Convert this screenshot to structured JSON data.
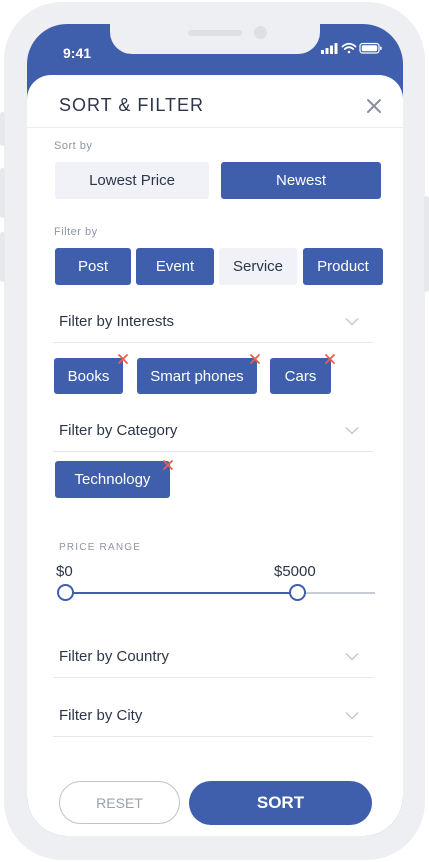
{
  "status_bar": {
    "time": "9:41"
  },
  "sheet": {
    "title": "SORT & FILTER"
  },
  "sort": {
    "label": "Sort by",
    "options": [
      {
        "label": "Lowest Price",
        "selected": false
      },
      {
        "label": "Newest",
        "selected": true
      }
    ]
  },
  "filter": {
    "label": "Filter by",
    "options": [
      {
        "label": "Post",
        "selected": true
      },
      {
        "label": "Event",
        "selected": true
      },
      {
        "label": "Service",
        "selected": false
      },
      {
        "label": "Product",
        "selected": true
      }
    ]
  },
  "interests": {
    "dropdown_label": "Filter by Interests",
    "chips": [
      "Books",
      "Smart phones",
      "Cars"
    ]
  },
  "category": {
    "dropdown_label": "Filter by Category",
    "chips": [
      "Technology"
    ]
  },
  "price_range": {
    "label": "PRICE RANGE",
    "min_label": "$0",
    "max_label": "$5000",
    "selected_min_fraction": 0.0,
    "selected_max_fraction": 0.75
  },
  "country": {
    "dropdown_label": "Filter by Country"
  },
  "city": {
    "dropdown_label": "Filter by City"
  },
  "actions": {
    "reset_label": "RESET",
    "sort_label": "SORT"
  },
  "colors": {
    "accent": "#3f5fad",
    "chip_remove": "#e8604c",
    "unselected_bg": "#f1f2f7",
    "text": "#2d3548",
    "muted": "#8f95a3"
  },
  "icons": {
    "close": "close-icon",
    "chevron": "chevron-down-icon",
    "chip_remove": "remove-chip-icon",
    "signal": "signal-icon",
    "wifi": "wifi-icon",
    "battery": "battery-icon"
  }
}
